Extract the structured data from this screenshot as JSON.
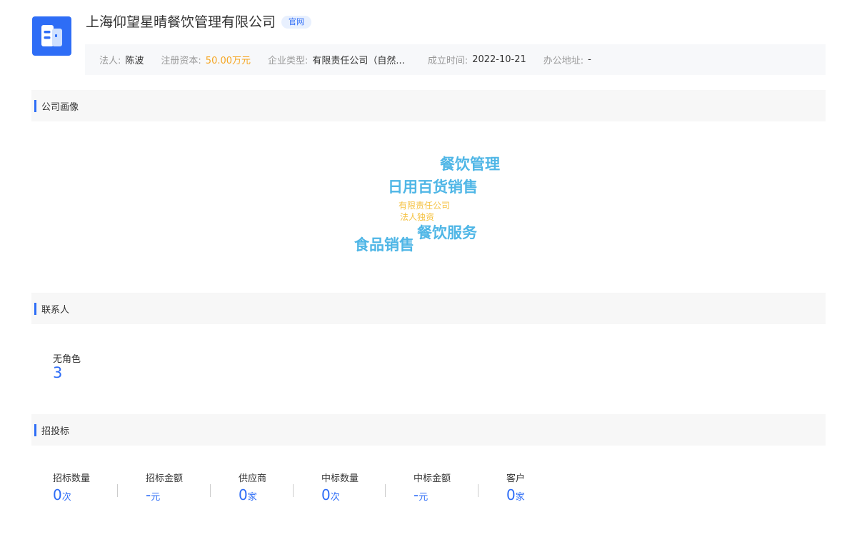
{
  "company": {
    "name": "上海仰望星晴餐饮管理有限公司",
    "official_site_tag": "官网",
    "icon": "building-icon",
    "brand_color": "#2e6df6"
  },
  "info": {
    "legal_person_label": "法人:",
    "legal_person": "陈波",
    "capital_label": "注册资本:",
    "capital": "50.00万元",
    "type_label": "企业类型:",
    "type": "有限责任公司（自然...",
    "founded_label": "成立时间:",
    "founded": "2022-10-21",
    "address_label": "办公地址:",
    "address": "-"
  },
  "profile": {
    "title": "公司画像",
    "words": [
      "餐饮管理",
      "日用百货销售",
      "有限责任公司",
      "法人独资",
      "餐饮服务",
      "食品销售"
    ],
    "word_colors": {
      "primary": "#4fb6e6",
      "secondary": "#f5c242"
    }
  },
  "contacts": {
    "title": "联系人",
    "role_label": "无角色",
    "role_count": "3"
  },
  "bidding": {
    "title": "招投标",
    "stats": [
      {
        "label": "招标数量",
        "value": "0",
        "unit": "次"
      },
      {
        "label": "招标金额",
        "value": "-",
        "unit": "元"
      },
      {
        "label": "供应商",
        "value": "0",
        "unit": "家"
      },
      {
        "label": "中标数量",
        "value": "0",
        "unit": "次"
      },
      {
        "label": "中标金额",
        "value": "-",
        "unit": "元"
      },
      {
        "label": "客户",
        "value": "0",
        "unit": "家"
      }
    ]
  }
}
